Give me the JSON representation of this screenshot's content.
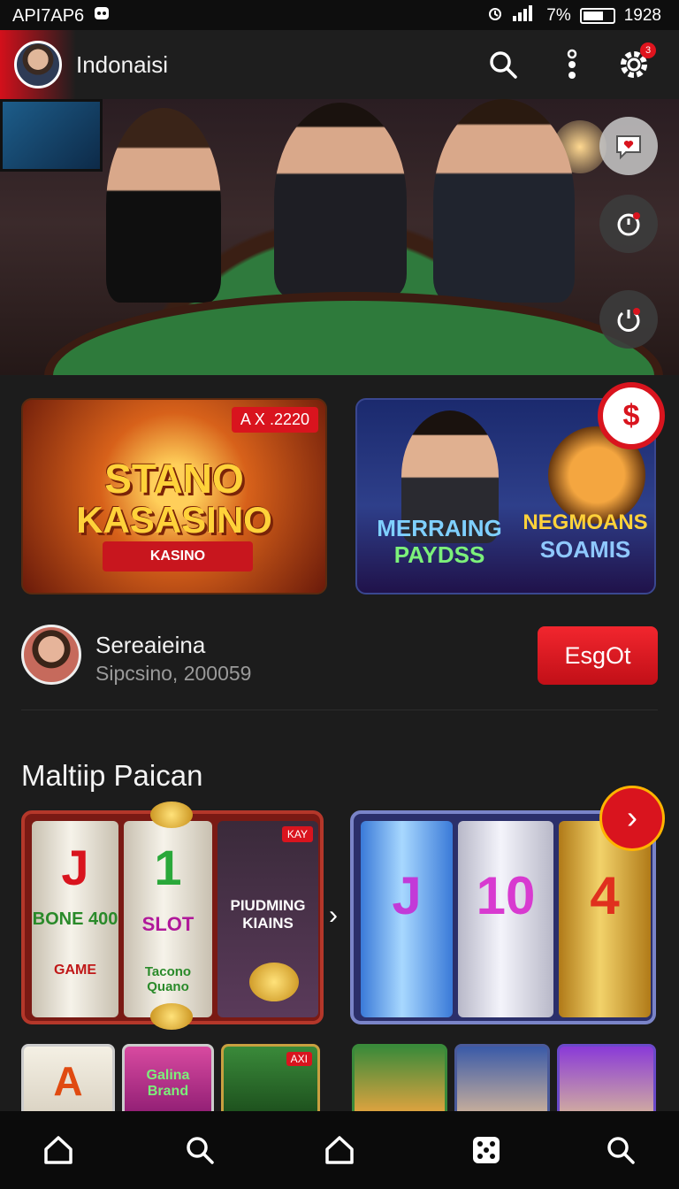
{
  "status_bar": {
    "left_text": "API7AP6",
    "battery": "7%",
    "time": "1928"
  },
  "app_bar": {
    "title": "Indonaisi",
    "notification_count": "3",
    "icons": [
      "search-icon",
      "more-vertical-icon",
      "settings-gear-icon"
    ]
  },
  "hero": {
    "side_buttons": [
      "chat-bubble-icon",
      "timer-icon",
      "power-timer-icon"
    ]
  },
  "promos": {
    "left": {
      "badge": "A X .2220",
      "headline_line1": "STANO",
      "headline_line2": "KASASINO",
      "ribbon": "KASINO"
    },
    "right": {
      "line1": "MERRAING",
      "line2": "PAYDSS",
      "line3": "NEGMOANS",
      "line4": "SOAMIS",
      "badge_symbol": "$"
    }
  },
  "user": {
    "name": "Sereaieina",
    "subtitle": "Sipcsino, 200059",
    "cta_label": "EsgOt"
  },
  "section": {
    "title": "Maltiip Paican",
    "slot_left": {
      "reel1_top": "J",
      "reel1_mid": "BONE 400",
      "reel1_bottom": "GAME",
      "reel2_top": "1",
      "reel2_mid": "SLOT",
      "reel2_bottom": "Tacono Quano",
      "tag": "KAY",
      "reel3_caption": "PIUDMING KIAINS"
    },
    "slot_right": {
      "reel1": "J",
      "reel2": "10",
      "reel3": "4"
    },
    "thumbs": [
      "A",
      "Galina Brand",
      "AXI"
    ]
  },
  "accent_colors": {
    "brand_red": "#d9141e",
    "gold": "#ffd23a"
  },
  "bottom_nav": [
    "home-icon",
    "search-icon",
    "home-outline-icon",
    "dice-icon",
    "search-icon"
  ]
}
